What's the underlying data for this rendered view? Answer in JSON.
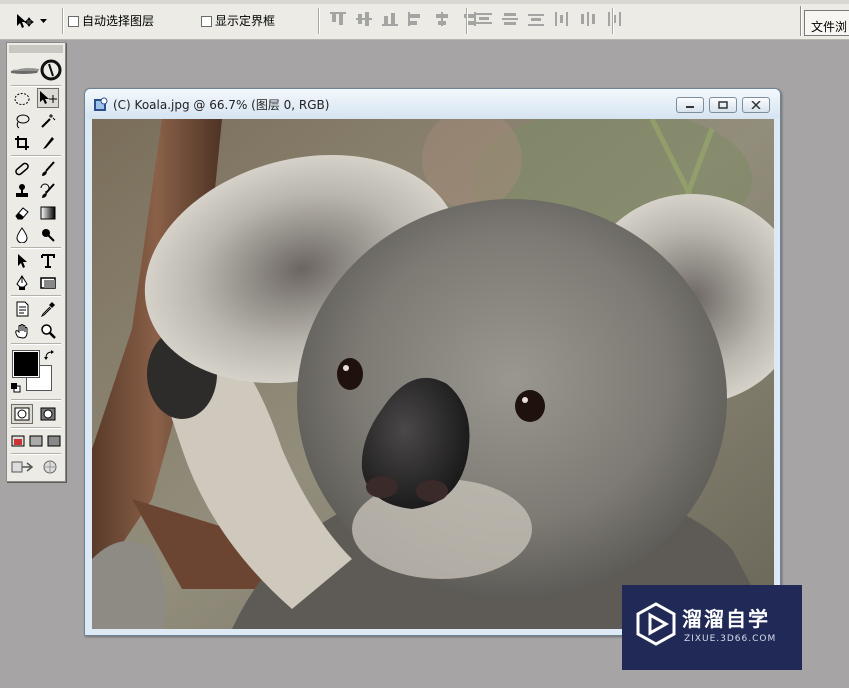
{
  "options_bar": {
    "tool_preset_icon": "move-tool-icon",
    "auto_select_label": "自动选择图层",
    "show_bounding_label": "显示定界框",
    "file_browser_label": "文件浏"
  },
  "toolbox": {
    "tools": [
      "rect-marquee",
      "move",
      "lasso",
      "magic-wand",
      "crop",
      "slice",
      "healing-brush",
      "brush",
      "clone-stamp",
      "history-brush",
      "eraser",
      "gradient",
      "blur",
      "dodge",
      "path-select",
      "type",
      "pen",
      "shape",
      "notes",
      "eyedropper",
      "hand",
      "zoom"
    ],
    "foreground_color": "#000000",
    "background_color": "#ffffff"
  },
  "document": {
    "title": "(C) Koala.jpg @ 66.7% (图层 0, RGB)",
    "image_subject": "koala"
  },
  "watermark": {
    "main": "溜溜自学",
    "sub": "ZIXUE.3D66.COM"
  },
  "colors": {
    "workspace": "#a6a4a5",
    "toolbar": "#ecebe6",
    "doc_title_bg": "#dde9f4",
    "watermark_bg": "#212a56"
  }
}
